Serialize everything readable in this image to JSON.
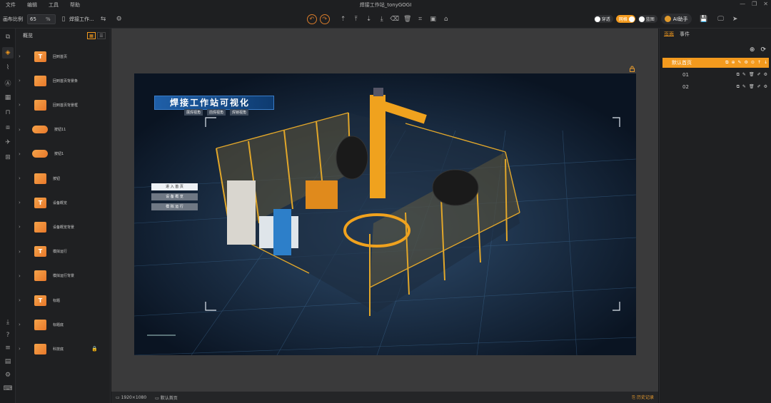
{
  "app": {
    "title": "焊接工作站_tonyGOGI"
  },
  "menu": [
    "文件",
    "编辑",
    "工具",
    "帮助"
  ],
  "toolbar": {
    "scale_label": "画布比例",
    "scale_value": "65",
    "scale_unit": "%",
    "page_name": "焊接工作...",
    "toggles": [
      {
        "label": "穿透",
        "on": false
      },
      {
        "label": "网格",
        "on": true
      },
      {
        "label": "蓝图",
        "on": false
      }
    ],
    "ai_label": "AI助手"
  },
  "layers_panel": {
    "title": "概览",
    "items": [
      {
        "label": "回到首页",
        "thumb": "T",
        "type": "text"
      },
      {
        "label": "回到首页背景条",
        "thumb": "",
        "type": "image"
      },
      {
        "label": "回到首页背景框",
        "thumb": "",
        "type": "image"
      },
      {
        "label": "按钮11",
        "thumb": "",
        "type": "pill"
      },
      {
        "label": "按钮1",
        "thumb": "",
        "type": "pill"
      },
      {
        "label": "按钮",
        "thumb": "",
        "type": "image"
      },
      {
        "label": "设备概览",
        "thumb": "T",
        "type": "text"
      },
      {
        "label": "设备概览背景",
        "thumb": "",
        "type": "image"
      },
      {
        "label": "模拟运行",
        "thumb": "T",
        "type": "text"
      },
      {
        "label": "模拟运行背景",
        "thumb": "",
        "type": "image"
      },
      {
        "label": "标题",
        "thumb": "T",
        "type": "text"
      },
      {
        "label": "标题底",
        "thumb": "",
        "type": "image"
      },
      {
        "label": "科技底",
        "thumb": "",
        "type": "image",
        "locked": true
      }
    ]
  },
  "canvas": {
    "title": "焊接工作站可视化",
    "tags": [
      "展焊视角",
      "前焊视角",
      "焊锁视角"
    ],
    "buttons": [
      "进 入 首 页",
      "设 备 概 览",
      "模 拟 运 行"
    ]
  },
  "status": {
    "resolution": "1920×1080",
    "page": "默认首页",
    "history": "历史记录"
  },
  "right_panel": {
    "tabs": [
      "页面",
      "事件"
    ],
    "pages": [
      {
        "name": "默认首页",
        "active": true
      },
      {
        "name": "01",
        "active": false
      },
      {
        "name": "02",
        "active": false
      }
    ]
  }
}
